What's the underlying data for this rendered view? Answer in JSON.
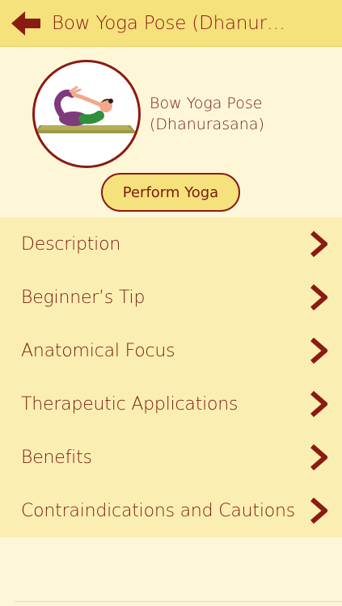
{
  "header": {
    "title": "Bow Yoga Pose (Dhanurasa...",
    "back_icon": "back-arrow-icon"
  },
  "pose": {
    "name_line1": "Bow Yoga Pose",
    "name_line2": "(Dhanurasana)",
    "image_icon": "bow-pose-illustration"
  },
  "actions": {
    "perform_label": "Perform Yoga"
  },
  "menu": {
    "items": [
      {
        "label": "Description"
      },
      {
        "label": "Beginner’s Tip"
      },
      {
        "label": "Anatomical Focus"
      },
      {
        "label": "Therapeutic Applications"
      },
      {
        "label": "Benefits"
      },
      {
        "label": "Contraindications and Cautions"
      }
    ]
  },
  "colors": {
    "header_bg": "#f6e27d",
    "page_bg": "#fdf7d8",
    "menu_bg": "#fbeeb2",
    "accent": "#8a1b12"
  }
}
